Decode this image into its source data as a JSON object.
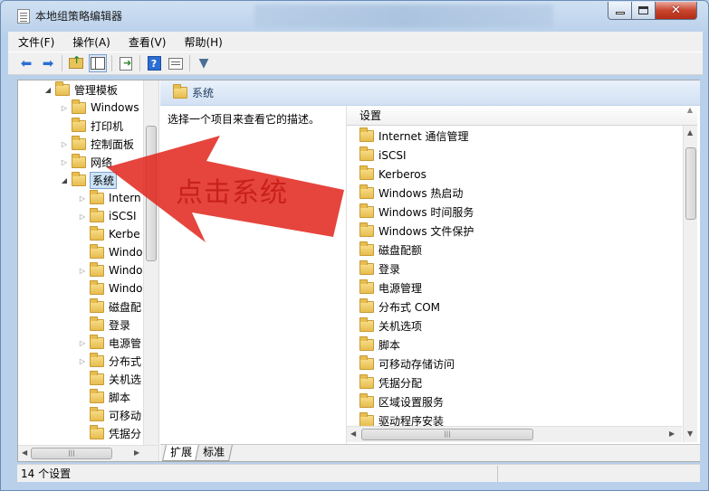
{
  "window": {
    "title": "本地组策略编辑器",
    "min_label": "",
    "max_label": "",
    "close_label": "✕"
  },
  "menu": [
    {
      "label": "文件(F)"
    },
    {
      "label": "操作(A)"
    },
    {
      "label": "查看(V)"
    },
    {
      "label": "帮助(H)"
    }
  ],
  "toolbar": {
    "back_icon": "back-arrow-icon",
    "forward_icon": "forward-arrow-icon",
    "help_label": "?"
  },
  "tree": {
    "rows": [
      {
        "label": "管理模板",
        "state": "expanded"
      },
      {
        "label": "Windows",
        "state": "collapsed"
      },
      {
        "label": "打印机",
        "state": "leaf"
      },
      {
        "label": "控制面板",
        "state": "collapsed"
      },
      {
        "label": "网络",
        "state": "collapsed"
      },
      {
        "label": "系统",
        "state": "expanded",
        "selected": true
      },
      {
        "label": "Intern",
        "state": "collapsed"
      },
      {
        "label": "iSCSI",
        "state": "collapsed"
      },
      {
        "label": "Kerbe",
        "state": "leaf"
      },
      {
        "label": "Windo",
        "state": "leaf"
      },
      {
        "label": "Windo",
        "state": "collapsed"
      },
      {
        "label": "Windo",
        "state": "leaf"
      },
      {
        "label": "磁盘配",
        "state": "leaf"
      },
      {
        "label": "登录",
        "state": "leaf"
      },
      {
        "label": "电源管",
        "state": "collapsed"
      },
      {
        "label": "分布式",
        "state": "collapsed"
      },
      {
        "label": "关机选",
        "state": "leaf"
      },
      {
        "label": "脚本",
        "state": "leaf"
      },
      {
        "label": "可移动",
        "state": "leaf"
      },
      {
        "label": "凭据分",
        "state": "leaf"
      }
    ]
  },
  "right": {
    "header_title": "系统",
    "description": "选择一个项目来查看它的描述。",
    "column_header": "设置",
    "items": [
      "Internet 通信管理",
      "iSCSI",
      "Kerberos",
      "Windows 热启动",
      "Windows 时间服务",
      "Windows 文件保护",
      "磁盘配额",
      "登录",
      "电源管理",
      "分布式 COM",
      "关机选项",
      "脚本",
      "可移动存储访问",
      "凭据分配",
      "区域设置服务",
      "驱动程序安装"
    ],
    "tabs": [
      {
        "label": "扩展"
      },
      {
        "label": "标准"
      }
    ]
  },
  "status": {
    "text": "14 个设置"
  },
  "annotation": {
    "text": "点击系统",
    "color": "#e0251b"
  }
}
